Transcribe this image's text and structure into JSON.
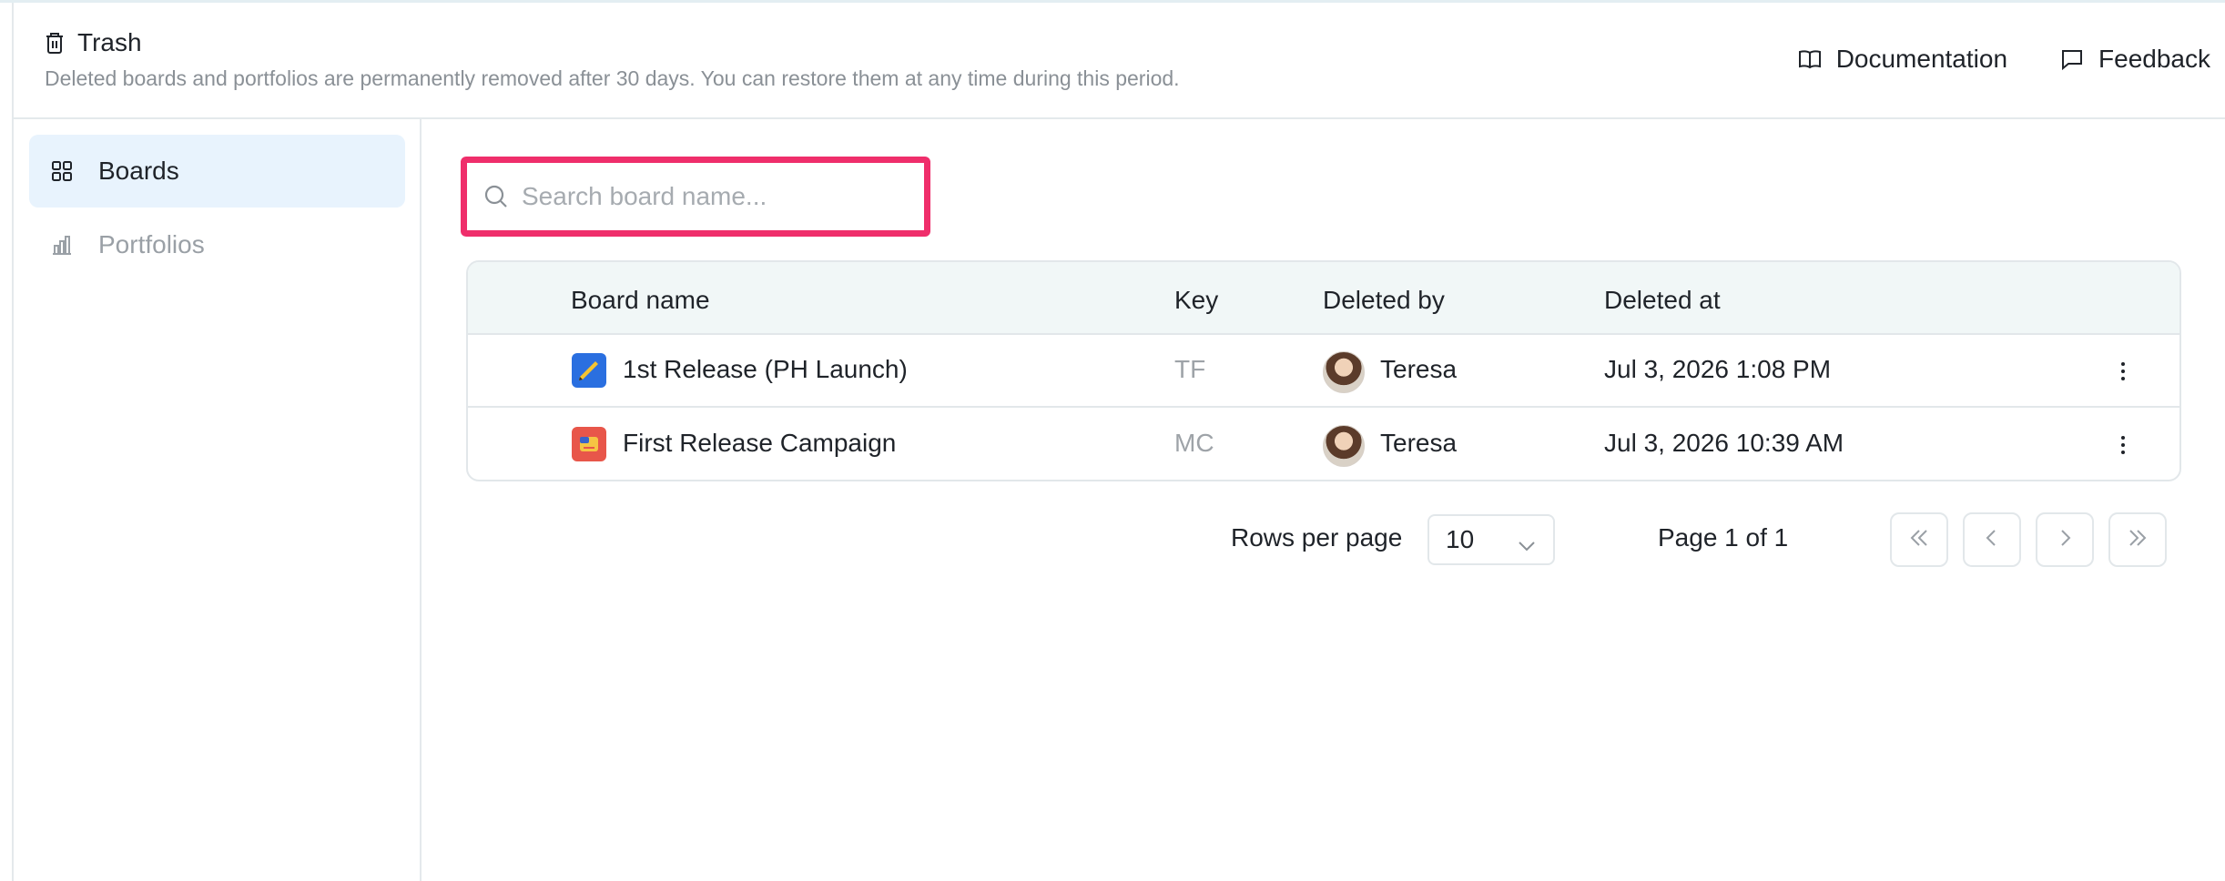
{
  "header": {
    "title": "Trash",
    "subtitle": "Deleted boards and portfolios are permanently removed after 30 days. You can restore them at any time during this period.",
    "links": {
      "documentation": "Documentation",
      "feedback": "Feedback"
    }
  },
  "sidebar": {
    "items": [
      {
        "label": "Boards",
        "icon": "grid-icon",
        "active": true
      },
      {
        "label": "Portfolios",
        "icon": "bar-chart-icon",
        "active": false
      }
    ]
  },
  "search": {
    "placeholder": "Search board name...",
    "value": ""
  },
  "table": {
    "columns": {
      "board_name": "Board name",
      "key": "Key",
      "deleted_by": "Deleted by",
      "deleted_at": "Deleted at"
    },
    "rows": [
      {
        "board_name": "1st Release (PH Launch)",
        "key": "TF",
        "deleted_by": "Teresa",
        "deleted_at": "Jul 3, 2026 1:08 PM",
        "icon": "pencil-board-icon"
      },
      {
        "board_name": "First Release Campaign",
        "key": "MC",
        "deleted_by": "Teresa",
        "deleted_at": "Jul 3, 2026 10:39 AM",
        "icon": "campaign-board-icon"
      }
    ]
  },
  "pagination": {
    "rows_per_page_label": "Rows per page",
    "rows_per_page_value": "10",
    "page_label": "Page 1 of 1"
  },
  "colors": {
    "accent_highlight": "#ef2e6b",
    "active_nav_bg": "#e8f3fd",
    "table_header_bg": "#f1f7f7"
  }
}
